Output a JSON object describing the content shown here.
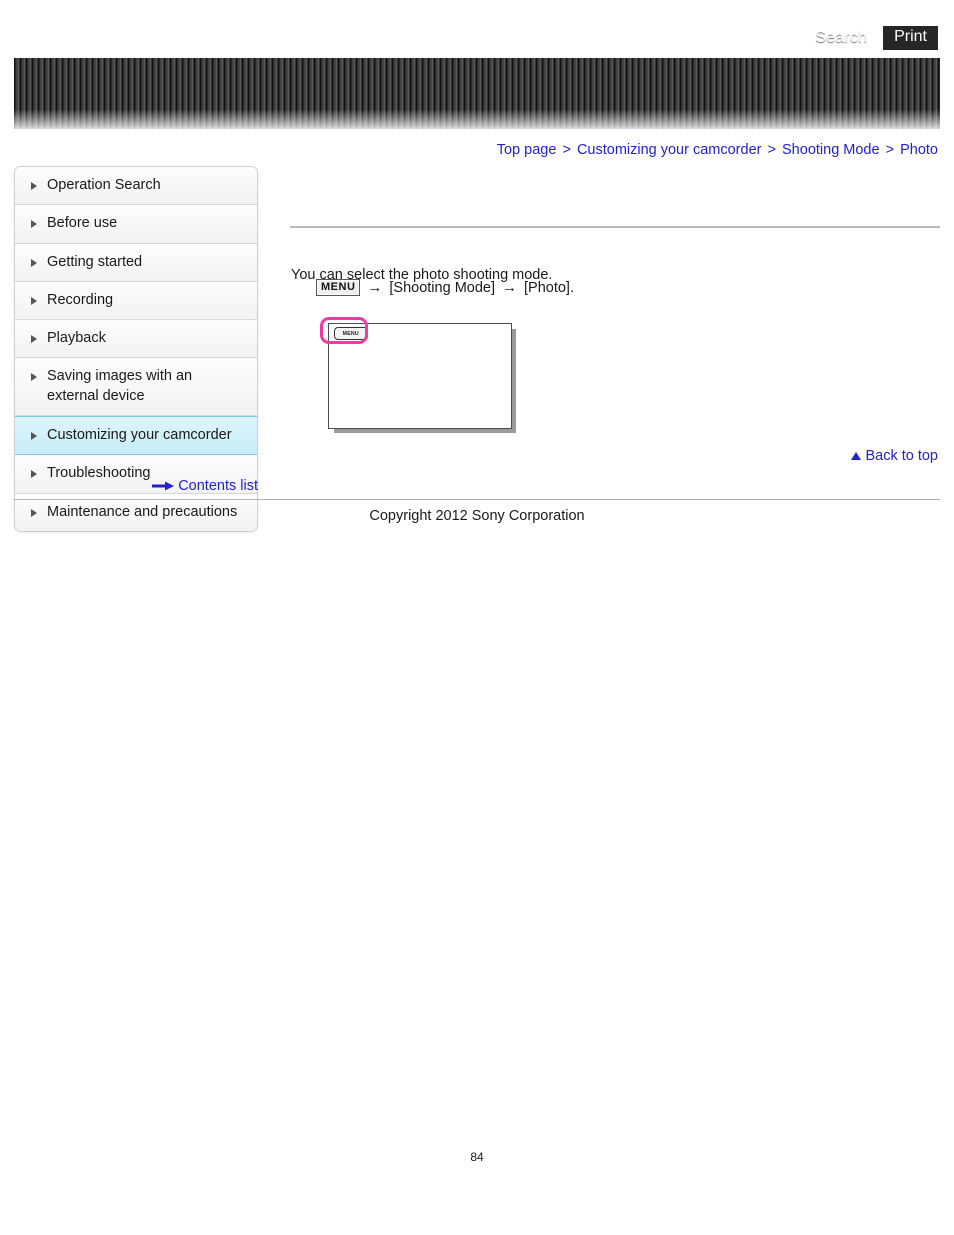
{
  "header": {
    "search_label": "Search",
    "print_label": "Print"
  },
  "breadcrumb": {
    "separator": ">",
    "items": [
      {
        "label": "Top page"
      },
      {
        "label": "Customizing your camcorder"
      },
      {
        "label": "Shooting Mode"
      },
      {
        "label": "Photo"
      }
    ]
  },
  "sidebar": {
    "items": [
      {
        "label": "Operation Search",
        "active": false
      },
      {
        "label": "Before use",
        "active": false
      },
      {
        "label": "Getting started",
        "active": false
      },
      {
        "label": "Recording",
        "active": false
      },
      {
        "label": "Playback",
        "active": false
      },
      {
        "label": "Saving images with an external device",
        "active": false
      },
      {
        "label": "Customizing your camcorder",
        "active": true
      },
      {
        "label": "Troubleshooting",
        "active": false
      },
      {
        "label": "Maintenance and precautions",
        "active": false
      }
    ],
    "contents_list_label": "Contents list"
  },
  "main": {
    "intro": "You can select the photo shooting mode.",
    "step": {
      "menu_chip": "MENU",
      "arrow": "→",
      "target_1": "[Shooting Mode]",
      "target_2": "[Photo]."
    },
    "illustration": {
      "menu_button_label": "MENU",
      "highlight_color": "#ef3ba2"
    },
    "back_to_top_label": "Back to top"
  },
  "footer": {
    "copyright": "Copyright 2012 Sony Corporation",
    "page_number": "84"
  },
  "colors": {
    "link": "#2222cc",
    "active_nav": "#c8edf7",
    "banner_dark": "#2a2a2a"
  }
}
